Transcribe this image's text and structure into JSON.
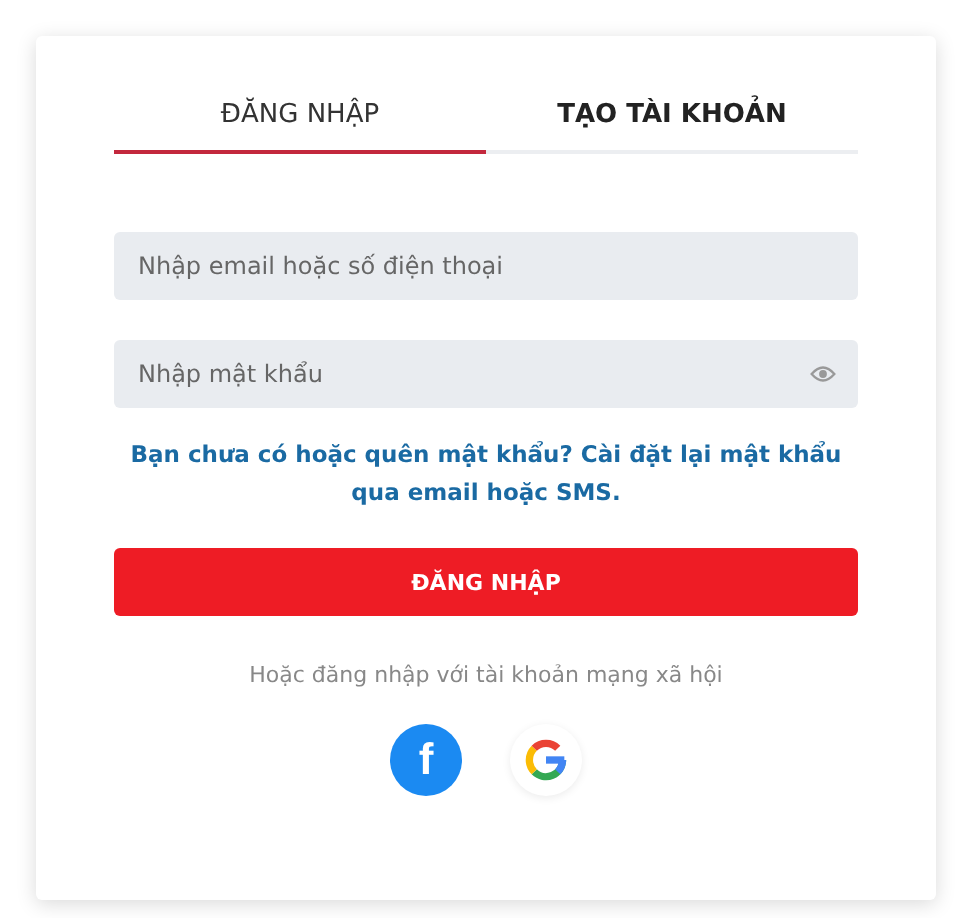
{
  "tabs": [
    {
      "label": "ĐĂNG NHẬP",
      "selected": true
    },
    {
      "label": "TẠO TÀI KHOẢN",
      "selected": false
    }
  ],
  "email_field": {
    "placeholder": "Nhập email hoặc số điện thoại"
  },
  "password_field": {
    "placeholder": "Nhập mật khẩu"
  },
  "reset_link": "Bạn chưa có hoặc quên mật khẩu? Cài đặt lại mật khẩu qua email hoặc SMS.",
  "submit_button": "ĐĂNG NHẬP",
  "social_caption": "Hoặc đăng nhập với tài khoản mạng xã hội",
  "social_buttons": [
    {
      "kind": "facebook",
      "mark": "f"
    },
    {
      "kind": "google"
    }
  ]
}
